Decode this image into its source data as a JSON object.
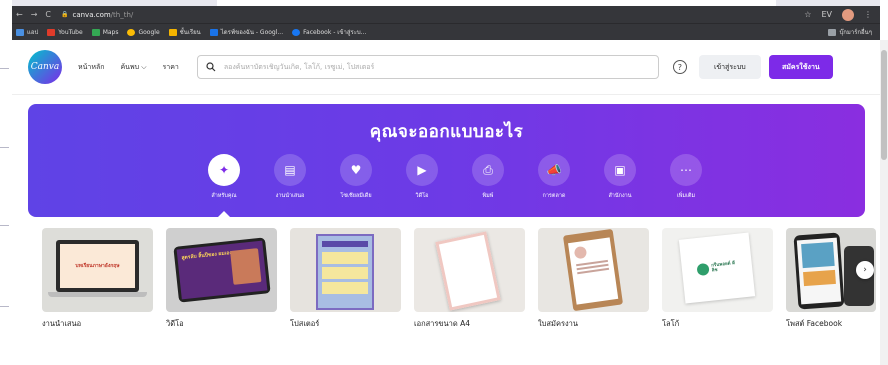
{
  "browser": {
    "url_host": "canva.com",
    "url_path": "/th_th/",
    "nav_back": "←",
    "nav_forward": "→",
    "nav_reload": "C",
    "lock": "🔒",
    "right_icons": [
      "☆",
      "EV",
      "⋮"
    ]
  },
  "bookmarks": {
    "items": [
      {
        "label": "แอป",
        "color": "#4a90e2"
      },
      {
        "label": "YouTube",
        "color": "#e03b2a"
      },
      {
        "label": "Maps",
        "color": "#34a853"
      },
      {
        "label": "Google",
        "color": "#fbbc05"
      },
      {
        "label": "ชั้นเรียน",
        "color": "#f4b400"
      },
      {
        "label": "ไดรฟ์ของฉัน - Googl...",
        "color": "#1a73e8"
      },
      {
        "label": "Facebook - เข้าสู่ระบ...",
        "color": "#1877f2"
      }
    ],
    "other": "บุ๊กมาร์กอื่นๆ"
  },
  "header": {
    "logo_text": "Canva",
    "nav": [
      "หน้าหลัก",
      "ค้นพบ ⌵",
      "ราคา"
    ],
    "search_placeholder": "ลองค้นหาบัตรเชิญวันเกิด, โลโก้, เรซูเม่, โปสเตอร์",
    "help": "?",
    "login": "เข้าสู่ระบบ",
    "signup": "สมัครใช้งาน",
    "brand_color": "#7d2ae8"
  },
  "hero": {
    "title": "คุณจะออกแบบอะไร",
    "categories": [
      {
        "icon": "✦",
        "label": "สำหรับคุณ",
        "active": true
      },
      {
        "icon": "▤",
        "label": "งานนำเสนอ",
        "active": false
      },
      {
        "icon": "♥",
        "label": "โซเชียลมีเดีย",
        "active": false
      },
      {
        "icon": "▶",
        "label": "วิดีโอ",
        "active": false
      },
      {
        "icon": "⎙",
        "label": "พิมพ์",
        "active": false
      },
      {
        "icon": "📣",
        "label": "การตลาด",
        "active": false
      },
      {
        "icon": "▣",
        "label": "สำนักงาน",
        "active": false
      },
      {
        "icon": "⋯",
        "label": "เพิ่มเติม",
        "active": false
      }
    ]
  },
  "templates": {
    "items": [
      {
        "label": "งานนำเสนอ",
        "inner": "บทเรียนภาษาอังกฤษ"
      },
      {
        "label": "วิดีโอ",
        "inner": "สูตรลับ สิ้นปีของ ผมเอง"
      },
      {
        "label": "โปสเตอร์",
        "inner": ""
      },
      {
        "label": "เอกสารขนาด A4",
        "inner": ""
      },
      {
        "label": "ใบสมัครงาน",
        "inner": ""
      },
      {
        "label": "โลโก้",
        "inner": "กรีนพอยต์ ดีลิช"
      },
      {
        "label": "โพสต์ Facebook",
        "inner": ""
      }
    ],
    "next": "›"
  }
}
